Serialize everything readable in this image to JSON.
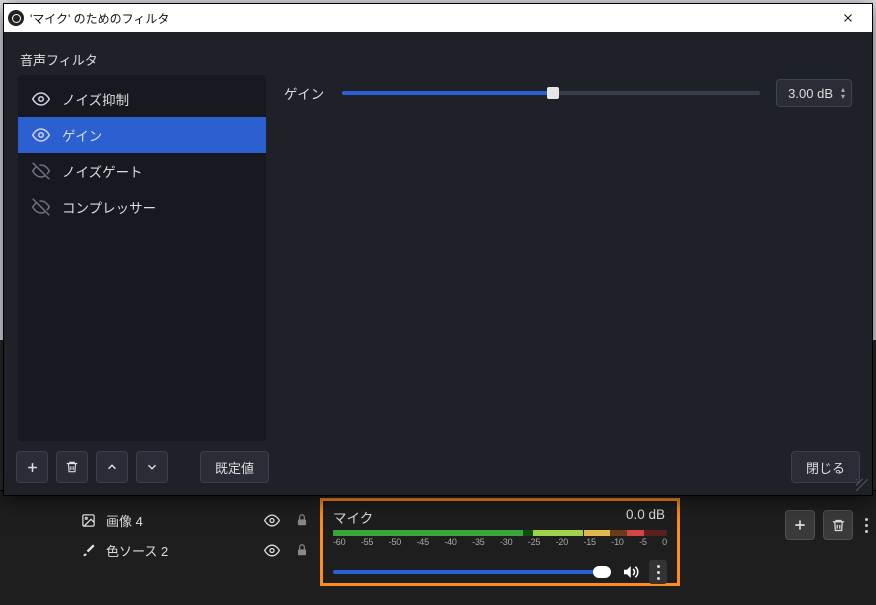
{
  "dialog": {
    "title": "'マイク' のためのフィルタ",
    "section_label": "音声フィルタ",
    "filters": [
      {
        "label": "ノイズ抑制",
        "enabled": true,
        "selected": false,
        "icon": "eye-icon"
      },
      {
        "label": "ゲイン",
        "enabled": true,
        "selected": true,
        "icon": "eye-icon"
      },
      {
        "label": "ノイズゲート",
        "enabled": false,
        "selected": false,
        "icon": "eye-off-icon"
      },
      {
        "label": "コンプレッサー",
        "enabled": false,
        "selected": false,
        "icon": "eye-off-icon"
      }
    ],
    "property": {
      "label": "ゲイン",
      "value_text": "3.00 dB",
      "slider_fill_pct": 50.5,
      "slider_thumb_pct": 50.5
    },
    "buttons": {
      "add": "+",
      "delete": "trash",
      "up": "▴",
      "down": "▾",
      "defaults": "既定値",
      "close": "閉じる"
    }
  },
  "sources": [
    {
      "label": "画像 4",
      "icon": "image-icon",
      "visible": true,
      "locked": true
    },
    {
      "label": "色ソース 2",
      "icon": "brush-icon",
      "visible": true,
      "locked": true
    }
  ],
  "mixer": {
    "name": "マイク",
    "level_text": "0.0 dB",
    "scale": [
      "-60",
      "-55",
      "-50",
      "-45",
      "-40",
      "-35",
      "-30",
      "-25",
      "-20",
      "-15",
      "-10",
      "-5",
      "0"
    ],
    "segments": [
      {
        "from": 0,
        "to": 57,
        "color": "#3aa53a"
      },
      {
        "from": 57,
        "to": 60,
        "color": "#0d4d0d"
      },
      {
        "from": 60,
        "to": 75,
        "color": "#9fd24b"
      },
      {
        "from": 75,
        "to": 83,
        "color": "#e0b84b"
      },
      {
        "from": 83,
        "to": 88,
        "color": "#6b3a1a"
      },
      {
        "from": 88,
        "to": 93,
        "color": "#d64545"
      },
      {
        "from": 93,
        "to": 100,
        "color": "#5a1f1f"
      }
    ],
    "volume_pct": 100
  },
  "colors": {
    "accent": "#2c5fcf",
    "highlight_border": "#ff8c1a"
  }
}
